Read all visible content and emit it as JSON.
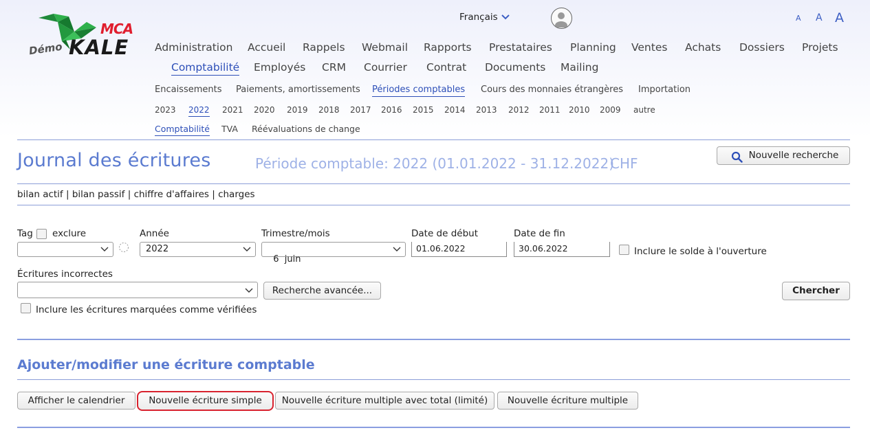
{
  "logo": {
    "mca": "MCA",
    "demo": "Démo",
    "kale": "KALE"
  },
  "topbar": {
    "language": "Français",
    "font_small": "A",
    "font_medium": "A",
    "font_large": "A"
  },
  "nav_main": [
    "Administration",
    "Accueil",
    "Rappels",
    "Webmail",
    "Rapports",
    "Prestataires",
    "Planning",
    "Ventes",
    "Achats",
    "Dossiers",
    "Projets"
  ],
  "nav_second": [
    "Comptabilité",
    "Employés",
    "CRM",
    "Courrier",
    "Contrat",
    "Documents",
    "Mailing"
  ],
  "subnav": [
    "Encaissements",
    "Paiements, amortissements",
    "Périodes comptables",
    "Cours des monnaies étrangères",
    "Importation"
  ],
  "years": [
    "2023",
    "2022",
    "2021",
    "2020",
    "2019",
    "2018",
    "2017",
    "2016",
    "2015",
    "2014",
    "2013",
    "2012",
    "2011",
    "2010",
    "2009",
    "autre"
  ],
  "subsub": [
    "Comptabilité",
    "TVA",
    "Réévaluations de change"
  ],
  "page": {
    "title": "Journal des écritures",
    "period": "Période comptable: 2022 (01.01.2022 - 31.12.2022)",
    "currency": "CHF",
    "new_search": "Nouvelle recherche"
  },
  "links": [
    "bilan actif",
    "bilan passif",
    "chiffre d'affaires",
    "charges"
  ],
  "filters": {
    "tag_label": "Tag",
    "exclude_label": "exclure",
    "tag_value": "",
    "year_label": "Année",
    "year_value": "2022",
    "quarter_label": "Trimestre/mois",
    "quarter_value": "6  juin",
    "start_label": "Date de début",
    "start_value": "01.06.2022",
    "end_label": "Date de fin",
    "end_value": "30.06.2022",
    "opening_balance_label": "Inclure le solde à l'ouverture",
    "incorrect_label": "Écritures incorrectes",
    "incorrect_value": "",
    "advanced_search": "Recherche avancée...",
    "search": "Chercher",
    "verified_label": "Inclure les écritures marquées comme vérifiées"
  },
  "add_section": {
    "title": "Ajouter/modifier une écriture comptable",
    "show_calendar": "Afficher le calendrier",
    "new_simple": "Nouvelle écriture simple",
    "new_multiple_total": "Nouvelle écriture multiple avec total (limité)",
    "new_multiple": "Nouvelle écriture multiple"
  }
}
